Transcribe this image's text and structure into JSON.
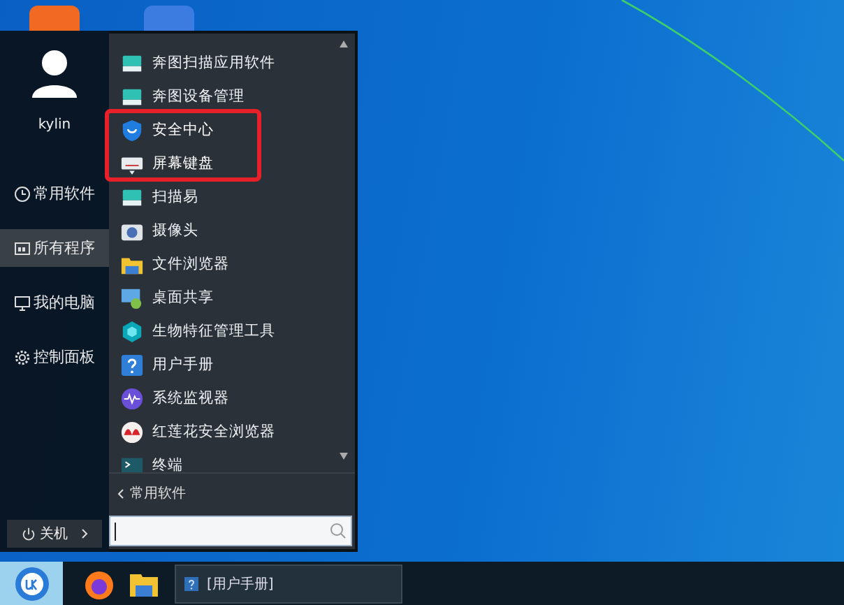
{
  "menu": {
    "user": {
      "name": "kylin"
    },
    "nav": [
      {
        "label": "常用软件",
        "selected": false
      },
      {
        "label": "所有程序",
        "selected": true
      },
      {
        "label": "我的电脑",
        "selected": false
      },
      {
        "label": "控制面板",
        "selected": false
      }
    ],
    "power": {
      "label": "关机"
    },
    "apps": [
      {
        "label": "奔图扫描应用软件"
      },
      {
        "label": "奔图设备管理"
      },
      {
        "label": "安全中心",
        "highlighted": true
      },
      {
        "label": "屏幕键盘",
        "highlighted": true
      },
      {
        "label": "扫描易"
      },
      {
        "label": "摄像头"
      },
      {
        "label": "文件浏览器"
      },
      {
        "label": "桌面共享"
      },
      {
        "label": "生物特征管理工具"
      },
      {
        "label": "用户手册"
      },
      {
        "label": "系统监视器"
      },
      {
        "label": "红莲花安全浏览器"
      },
      {
        "label": "终端"
      }
    ],
    "back": {
      "label": "常用软件"
    }
  },
  "taskbar": {
    "windows": [
      {
        "label": "[用户手册]"
      }
    ]
  }
}
